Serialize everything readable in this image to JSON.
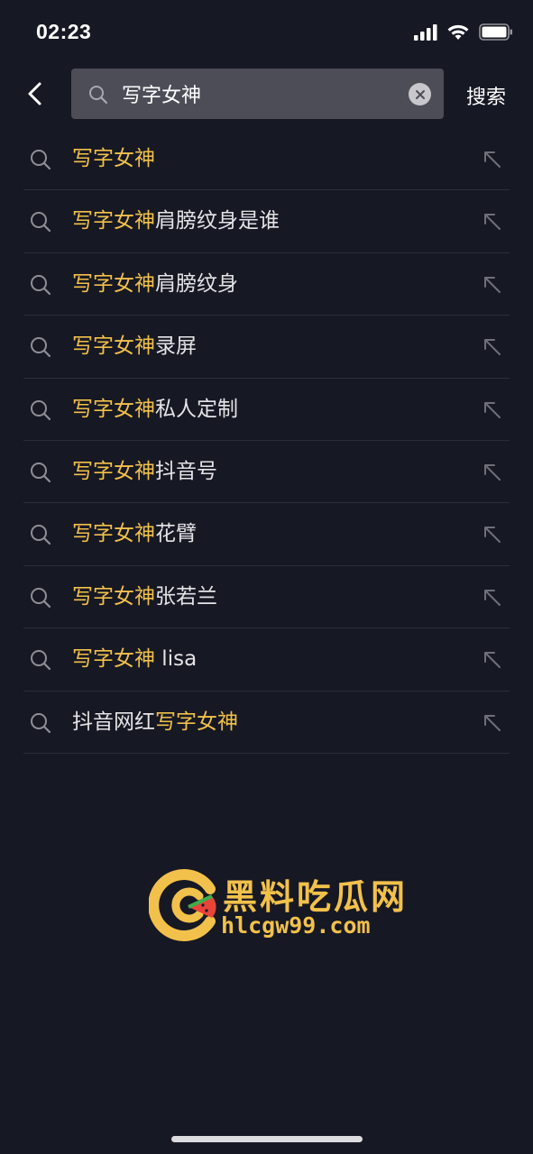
{
  "status_bar": {
    "time": "02:23",
    "icons": [
      "signal-icon",
      "wifi-icon",
      "battery-icon"
    ]
  },
  "search": {
    "query": "写字女神",
    "submit_label": "搜索",
    "icons": [
      "back-arrow-icon",
      "search-icon",
      "clear-icon"
    ]
  },
  "suggestions": [
    {
      "highlight": "写字女神",
      "rest": "",
      "order": "hl-first"
    },
    {
      "highlight": "写字女神",
      "rest": "肩膀纹身是谁",
      "order": "hl-first"
    },
    {
      "highlight": "写字女神",
      "rest": "肩膀纹身",
      "order": "hl-first"
    },
    {
      "highlight": "写字女神",
      "rest": "录屏",
      "order": "hl-first"
    },
    {
      "highlight": "写字女神",
      "rest": "私人定制",
      "order": "hl-first"
    },
    {
      "highlight": "写字女神",
      "rest": "抖音号",
      "order": "hl-first"
    },
    {
      "highlight": "写字女神",
      "rest": "花臂",
      "order": "hl-first"
    },
    {
      "highlight": "写字女神",
      "rest": "张若兰",
      "order": "hl-first"
    },
    {
      "highlight": "写字女神",
      "rest": " lisa",
      "order": "hl-first"
    },
    {
      "highlight": "写字女神",
      "rest": "抖音网红",
      "order": "rest-first"
    }
  ],
  "watermark": {
    "title": "黑料吃瓜网",
    "url": "hlcgw99.com"
  },
  "colors": {
    "background": "#161823",
    "highlight": "#f2c14b",
    "search_box": "#4c4d57",
    "divider": "#2b2d39"
  }
}
